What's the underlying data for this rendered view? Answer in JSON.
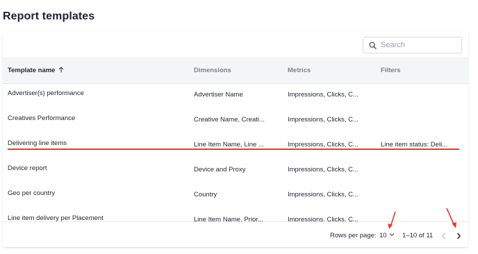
{
  "page": {
    "title": "Report templates"
  },
  "search": {
    "placeholder": "Search",
    "value": ""
  },
  "table": {
    "columns": [
      {
        "label": "Template name",
        "sorted": "ascending"
      },
      {
        "label": "Dimensions"
      },
      {
        "label": "Metrics"
      },
      {
        "label": "Filters"
      }
    ],
    "rows": [
      {
        "name": "Advertiser(s) performance",
        "dimensions": "Advertiser Name",
        "metrics": "Impressions, Clicks, C...",
        "filters": ""
      },
      {
        "name": "Creatives Performance",
        "dimensions": "Creative Name, Creati...",
        "metrics": "Impressions, Clicks, C...",
        "filters": ""
      },
      {
        "name": "Delivering line items",
        "dimensions": "Line Item Name, Line ...",
        "metrics": "Impressions, Clicks, C...",
        "filters": "Line item status: Deli..."
      },
      {
        "name": "Device report",
        "dimensions": "Device and Proxy",
        "metrics": "Impressions, Clicks, C...",
        "filters": ""
      },
      {
        "name": "Geo per country",
        "dimensions": "Country",
        "metrics": "Impressions, Clicks, C...",
        "filters": ""
      },
      {
        "name": "Line item delivery per Placement",
        "dimensions": "Line Item Name, Prior...",
        "metrics": "Impressions, Clicks, C...",
        "filters": ""
      }
    ]
  },
  "pagination": {
    "rows_per_page_label": "Rows per page:",
    "rows_per_page_value": "10",
    "range": "1–10 of 11"
  },
  "colors": {
    "annotation": "#e8382f",
    "header_bg": "#f4f5f7"
  },
  "icons": {
    "search": "search-icon",
    "sort": "sort-ascending-icon",
    "dropdown": "chevron-down-icon",
    "prev": "chevron-left-icon",
    "next": "chevron-right-icon"
  }
}
